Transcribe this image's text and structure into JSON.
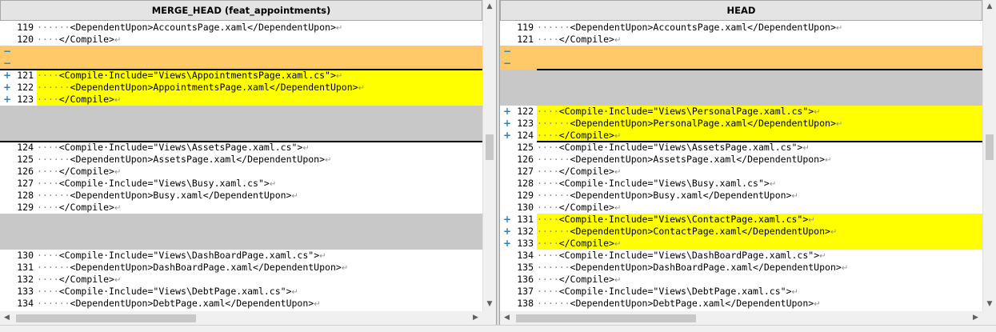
{
  "left": {
    "title": "MERGE_HEAD (feat_appointments)",
    "lines": [
      {
        "sign": "",
        "num": "119",
        "indent": 6,
        "code": "<DependentUpon>AccountsPage.xaml</DependentUpon>",
        "bg": ""
      },
      {
        "sign": "",
        "num": "120",
        "indent": 4,
        "code": "</Compile>",
        "bg": ""
      },
      {
        "sign": "−",
        "num": "",
        "indent": 0,
        "code": "",
        "bg": "orange"
      },
      {
        "sign": "−",
        "num": "",
        "indent": 0,
        "code": "",
        "bg": "orange"
      },
      {
        "sign": "+",
        "num": "121",
        "indent": 4,
        "code": "<Compile·Include=\"Views\\AppointmentsPage.xaml.cs\">",
        "bg": "yellow"
      },
      {
        "sign": "+",
        "num": "122",
        "indent": 6,
        "code": "<DependentUpon>AppointmentsPage.xaml</DependentUpon>",
        "bg": "yellow"
      },
      {
        "sign": "+",
        "num": "123",
        "indent": 4,
        "code": "</Compile>",
        "bg": "yellow"
      },
      {
        "sign": "",
        "num": "",
        "indent": 0,
        "code": "",
        "bg": "gray"
      },
      {
        "sign": "",
        "num": "",
        "indent": 0,
        "code": "",
        "bg": "gray"
      },
      {
        "sign": "",
        "num": "",
        "indent": 0,
        "code": "",
        "bg": "gray"
      },
      {
        "sign": "",
        "num": "124",
        "indent": 4,
        "code": "<Compile·Include=\"Views\\AssetsPage.xaml.cs\">",
        "bg": ""
      },
      {
        "sign": "",
        "num": "125",
        "indent": 6,
        "code": "<DependentUpon>AssetsPage.xaml</DependentUpon>",
        "bg": ""
      },
      {
        "sign": "",
        "num": "126",
        "indent": 4,
        "code": "</Compile>",
        "bg": ""
      },
      {
        "sign": "",
        "num": "127",
        "indent": 4,
        "code": "<Compile·Include=\"Views\\Busy.xaml.cs\">",
        "bg": ""
      },
      {
        "sign": "",
        "num": "128",
        "indent": 6,
        "code": "<DependentUpon>Busy.xaml</DependentUpon>",
        "bg": ""
      },
      {
        "sign": "",
        "num": "129",
        "indent": 4,
        "code": "</Compile>",
        "bg": ""
      },
      {
        "sign": "",
        "num": "",
        "indent": 0,
        "code": "",
        "bg": "gray"
      },
      {
        "sign": "",
        "num": "",
        "indent": 0,
        "code": "",
        "bg": "gray"
      },
      {
        "sign": "",
        "num": "",
        "indent": 0,
        "code": "",
        "bg": "gray"
      },
      {
        "sign": "",
        "num": "130",
        "indent": 4,
        "code": "<Compile·Include=\"Views\\DashBoardPage.xaml.cs\">",
        "bg": ""
      },
      {
        "sign": "",
        "num": "131",
        "indent": 6,
        "code": "<DependentUpon>DashBoardPage.xaml</DependentUpon>",
        "bg": ""
      },
      {
        "sign": "",
        "num": "132",
        "indent": 4,
        "code": "</Compile>",
        "bg": ""
      },
      {
        "sign": "",
        "num": "133",
        "indent": 4,
        "code": "<Compile·Include=\"Views\\DebtPage.xaml.cs\">",
        "bg": ""
      },
      {
        "sign": "",
        "num": "134",
        "indent": 6,
        "code": "<DependentUpon>DebtPage.xaml</DependentUpon>",
        "bg": ""
      }
    ]
  },
  "right": {
    "title": "HEAD",
    "lines": [
      {
        "sign": "",
        "num": "119",
        "indent": 6,
        "code": "<DependentUpon>AccountsPage.xaml</DependentUpon>",
        "bg": ""
      },
      {
        "sign": "",
        "num": "121",
        "indent": 4,
        "code": "</Compile>",
        "bg": ""
      },
      {
        "sign": "−",
        "num": "",
        "indent": 0,
        "code": "",
        "bg": "orange"
      },
      {
        "sign": "−",
        "num": "",
        "indent": 0,
        "code": "",
        "bg": "orange"
      },
      {
        "sign": "",
        "num": "",
        "indent": 0,
        "code": "",
        "bg": "gray"
      },
      {
        "sign": "",
        "num": "",
        "indent": 0,
        "code": "",
        "bg": "gray"
      },
      {
        "sign": "",
        "num": "",
        "indent": 0,
        "code": "",
        "bg": "gray"
      },
      {
        "sign": "+",
        "num": "122",
        "indent": 4,
        "code": "<Compile·Include=\"Views\\PersonalPage.xaml.cs\">",
        "bg": "yellow"
      },
      {
        "sign": "+",
        "num": "123",
        "indent": 6,
        "code": "<DependentUpon>PersonalPage.xaml</DependentUpon>",
        "bg": "yellow"
      },
      {
        "sign": "+",
        "num": "124",
        "indent": 4,
        "code": "</Compile>",
        "bg": "yellow"
      },
      {
        "sign": "",
        "num": "125",
        "indent": 4,
        "code": "<Compile·Include=\"Views\\AssetsPage.xaml.cs\">",
        "bg": ""
      },
      {
        "sign": "",
        "num": "126",
        "indent": 6,
        "code": "<DependentUpon>AssetsPage.xaml</DependentUpon>",
        "bg": ""
      },
      {
        "sign": "",
        "num": "127",
        "indent": 4,
        "code": "</Compile>",
        "bg": ""
      },
      {
        "sign": "",
        "num": "128",
        "indent": 4,
        "code": "<Compile·Include=\"Views\\Busy.xaml.cs\">",
        "bg": ""
      },
      {
        "sign": "",
        "num": "129",
        "indent": 6,
        "code": "<DependentUpon>Busy.xaml</DependentUpon>",
        "bg": ""
      },
      {
        "sign": "",
        "num": "130",
        "indent": 4,
        "code": "</Compile>",
        "bg": ""
      },
      {
        "sign": "+",
        "num": "131",
        "indent": 4,
        "code": "<Compile·Include=\"Views\\ContactPage.xaml.cs\">",
        "bg": "yellow"
      },
      {
        "sign": "+",
        "num": "132",
        "indent": 6,
        "code": "<DependentUpon>ContactPage.xaml</DependentUpon>",
        "bg": "yellow"
      },
      {
        "sign": "+",
        "num": "133",
        "indent": 4,
        "code": "</Compile>",
        "bg": "yellow"
      },
      {
        "sign": "",
        "num": "134",
        "indent": 4,
        "code": "<Compile·Include=\"Views\\DashBoardPage.xaml.cs\">",
        "bg": ""
      },
      {
        "sign": "",
        "num": "135",
        "indent": 6,
        "code": "<DependentUpon>DashBoardPage.xaml</DependentUpon>",
        "bg": ""
      },
      {
        "sign": "",
        "num": "136",
        "indent": 4,
        "code": "</Compile>",
        "bg": ""
      },
      {
        "sign": "",
        "num": "137",
        "indent": 4,
        "code": "<Compile·Include=\"Views\\DebtPage.xaml.cs\">",
        "bg": ""
      },
      {
        "sign": "",
        "num": "138",
        "indent": 6,
        "code": "<DependentUpon>DebtPage.xaml</DependentUpon>",
        "bg": ""
      }
    ]
  },
  "colors": {
    "added": "#ffff00",
    "removed": "#ffc868",
    "filler": "#c8c8c8",
    "gutter_sign": "#2f7fbf"
  },
  "icons": {
    "eol": "↵",
    "scroll_up": "▲",
    "scroll_down": "▼",
    "scroll_left": "◀",
    "scroll_right": "▶"
  }
}
